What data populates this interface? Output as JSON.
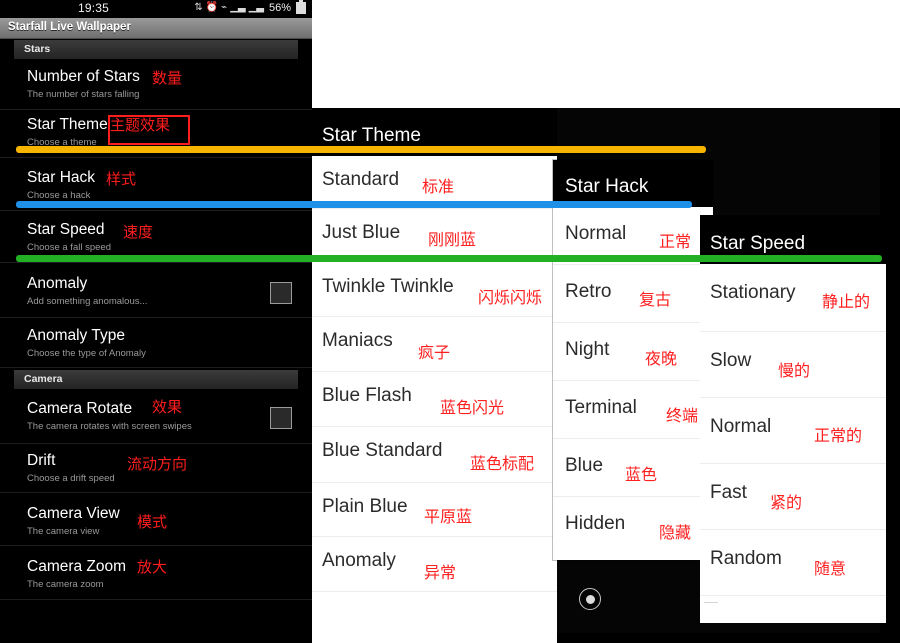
{
  "phone": {
    "status_bar": {
      "time": "19:35",
      "battery_text": "56%",
      "icons": [
        "sync-icon",
        "alarm-icon",
        "wifi-icon",
        "signal-1-icon",
        "signal-2-icon",
        "battery-icon"
      ]
    },
    "app_title": "Starfall Live Wallpaper",
    "sections": [
      {
        "label": "Stars"
      },
      {
        "label": "Camera"
      }
    ],
    "preferences": [
      {
        "title": "Number of Stars",
        "summary": "The number of stars falling",
        "zh": "数量",
        "has_checkbox": false
      },
      {
        "title": "Star Theme",
        "summary": "Choose a theme",
        "zh": "主题效果",
        "has_checkbox": false,
        "marker_color": "#f7b500"
      },
      {
        "title": "Star Hack",
        "summary": "Choose a hack",
        "zh": "样式",
        "has_checkbox": false,
        "marker_color": "#1e90e8"
      },
      {
        "title": "Star Speed",
        "summary": "Choose a fall speed",
        "zh": "速度",
        "has_checkbox": false,
        "marker_color": "#24b024"
      },
      {
        "title": "Anomaly",
        "summary": "Add something anomalous...",
        "zh": "",
        "has_checkbox": true
      },
      {
        "title": "Anomaly Type",
        "summary": "Choose the type of Anomaly",
        "zh": "",
        "has_checkbox": false
      },
      {
        "title": "Camera Rotate",
        "summary": "The camera rotates with screen swipes",
        "zh": "效果",
        "has_checkbox": true
      },
      {
        "title": "Drift",
        "summary": "Choose a drift speed",
        "zh": "流动方向",
        "has_checkbox": false
      },
      {
        "title": "Camera View",
        "summary": "The camera view",
        "zh": "模式",
        "has_checkbox": false
      },
      {
        "title": "Camera Zoom",
        "summary": "The camera zoom",
        "zh": "放大",
        "has_checkbox": false
      }
    ]
  },
  "dialogs": {
    "star_theme": {
      "title": "Star Theme",
      "options": [
        {
          "label": "Standard",
          "zh": "标准"
        },
        {
          "label": "Just Blue",
          "zh": "刚刚蓝"
        },
        {
          "label": "Twinkle Twinkle",
          "zh": "闪烁闪烁"
        },
        {
          "label": "Maniacs",
          "zh": "疯子"
        },
        {
          "label": "Blue Flash",
          "zh": "蓝色闪光"
        },
        {
          "label": "Blue Standard",
          "zh": "蓝色标配"
        },
        {
          "label": "Plain Blue",
          "zh": "平原蓝"
        },
        {
          "label": "Anomaly",
          "zh": "异常"
        }
      ]
    },
    "star_hack": {
      "title": "Star Hack",
      "options": [
        {
          "label": "Normal",
          "zh": "正常"
        },
        {
          "label": "Retro",
          "zh": "复古"
        },
        {
          "label": "Night",
          "zh": "夜晚"
        },
        {
          "label": "Terminal",
          "zh": "终端"
        },
        {
          "label": "Blue",
          "zh": "蓝色"
        },
        {
          "label": "Hidden",
          "zh": "隐藏"
        }
      ]
    },
    "star_speed": {
      "title": "Star Speed",
      "options": [
        {
          "label": "Stationary",
          "zh": "静止的"
        },
        {
          "label": "Slow",
          "zh": "慢的"
        },
        {
          "label": "Normal",
          "zh": "正常的"
        },
        {
          "label": "Fast",
          "zh": "紧的"
        },
        {
          "label": "Random",
          "zh": "随意"
        }
      ]
    }
  },
  "annotations": {
    "bars": [
      {
        "name": "theme-bar",
        "color": "#f7b500"
      },
      {
        "name": "hack-bar",
        "color": "#1e90e8"
      },
      {
        "name": "speed-bar",
        "color": "#24b024"
      }
    ]
  },
  "nav": {
    "home_button": "home-button"
  }
}
